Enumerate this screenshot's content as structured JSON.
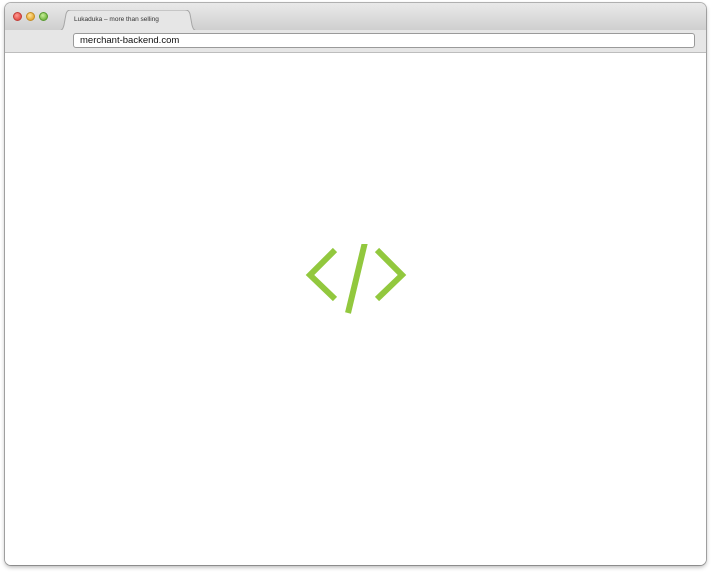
{
  "browser": {
    "tab_title": "Lukaduka – more than selling",
    "address": "merchant-backend.com"
  },
  "page": {
    "logo_icon": "code-brackets-icon",
    "accent_color": "#92c83e"
  }
}
